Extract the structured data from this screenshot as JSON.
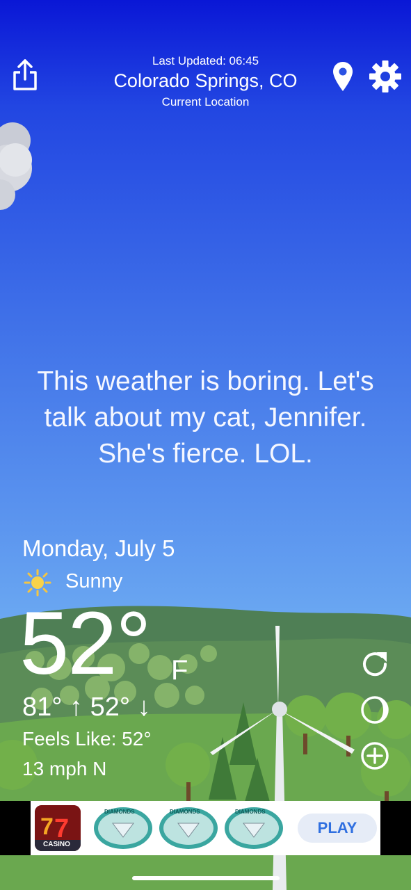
{
  "header": {
    "last_updated": "Last Updated: 06:45",
    "city": "Colorado Springs, CO",
    "location_label": "Current Location"
  },
  "message": "This weather is boring. Let's talk about my cat, Jennifer. She's fierce. LOL.",
  "weather": {
    "date": "Monday, July 5",
    "condition": "Sunny",
    "condition_icon": "sun-icon",
    "temperature": "52°",
    "unit": "F",
    "high_low": "81° ↑  52° ↓",
    "feels_like": "Feels Like: 52°",
    "wind": "13 mph N"
  },
  "ad": {
    "app_badge": "CASINO",
    "diamond_text": "DIAMONDS",
    "play_label": "PLAY"
  },
  "colors": {
    "sky_top": "#0a17d6",
    "sky_bottom": "#8cc7f6",
    "grass": "#6aa84f",
    "play_text": "#2f6fe0"
  }
}
